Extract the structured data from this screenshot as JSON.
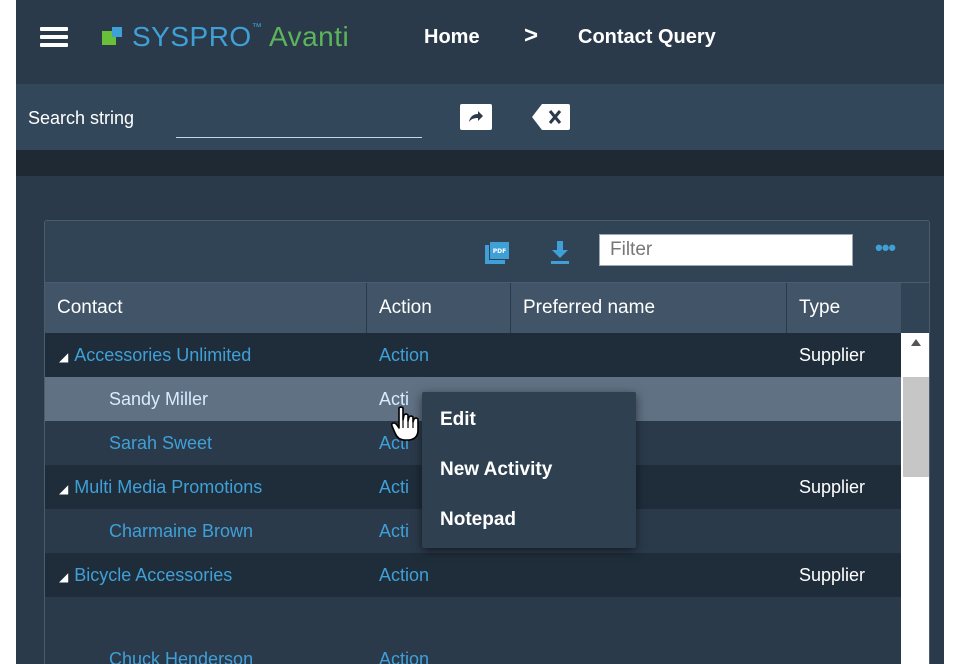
{
  "header": {
    "brand": "SYSPRO",
    "product": "Avanti",
    "breadcrumb": {
      "home": "Home",
      "separator": ">",
      "current": "Contact Query"
    }
  },
  "search": {
    "label": "Search string",
    "value": ""
  },
  "grid": {
    "filter_placeholder": "Filter",
    "more_label": "•••",
    "columns": [
      "Contact",
      "Action",
      "Preferred name",
      "Type"
    ],
    "rows": [
      {
        "contact": "Accessories Unlimited",
        "action": "Action",
        "preferred_name": "",
        "type": "Supplier",
        "level": "parent"
      },
      {
        "contact": "Sandy Miller",
        "action": "Action",
        "preferred_name": "",
        "type": "",
        "level": "child",
        "selected": true
      },
      {
        "contact": "Sarah Sweet",
        "action": "Action",
        "preferred_name": "",
        "type": "",
        "level": "child"
      },
      {
        "contact": "Multi Media Promotions",
        "action": "Action",
        "preferred_name": "",
        "type": "Supplier",
        "level": "parent"
      },
      {
        "contact": "Charmaine Brown",
        "action": "Action",
        "preferred_name": "",
        "type": "",
        "level": "child"
      },
      {
        "contact": "Bicycle Accessories",
        "action": "Action",
        "preferred_name": "",
        "type": "Supplier",
        "level": "parent"
      },
      {
        "contact": "Chuck Henderson",
        "action": "Action",
        "preferred_name": "",
        "type": "",
        "level": "child"
      }
    ],
    "visible_action_labels": [
      "Action",
      "Acti",
      "Acti",
      "Acti",
      "Acti",
      "Action",
      "Action"
    ]
  },
  "context_menu": {
    "items": [
      "Edit",
      "New Activity",
      "Notepad"
    ]
  },
  "colors": {
    "background": "#2b3a4b",
    "link": "#3fa0d8",
    "brand_green": "#6abf3a",
    "selected_row": "#5f7183"
  },
  "icons": [
    "hamburger-menu-icon",
    "arrow-go-icon",
    "clear-icon",
    "pdf-icon",
    "download-icon",
    "more-icon"
  ]
}
